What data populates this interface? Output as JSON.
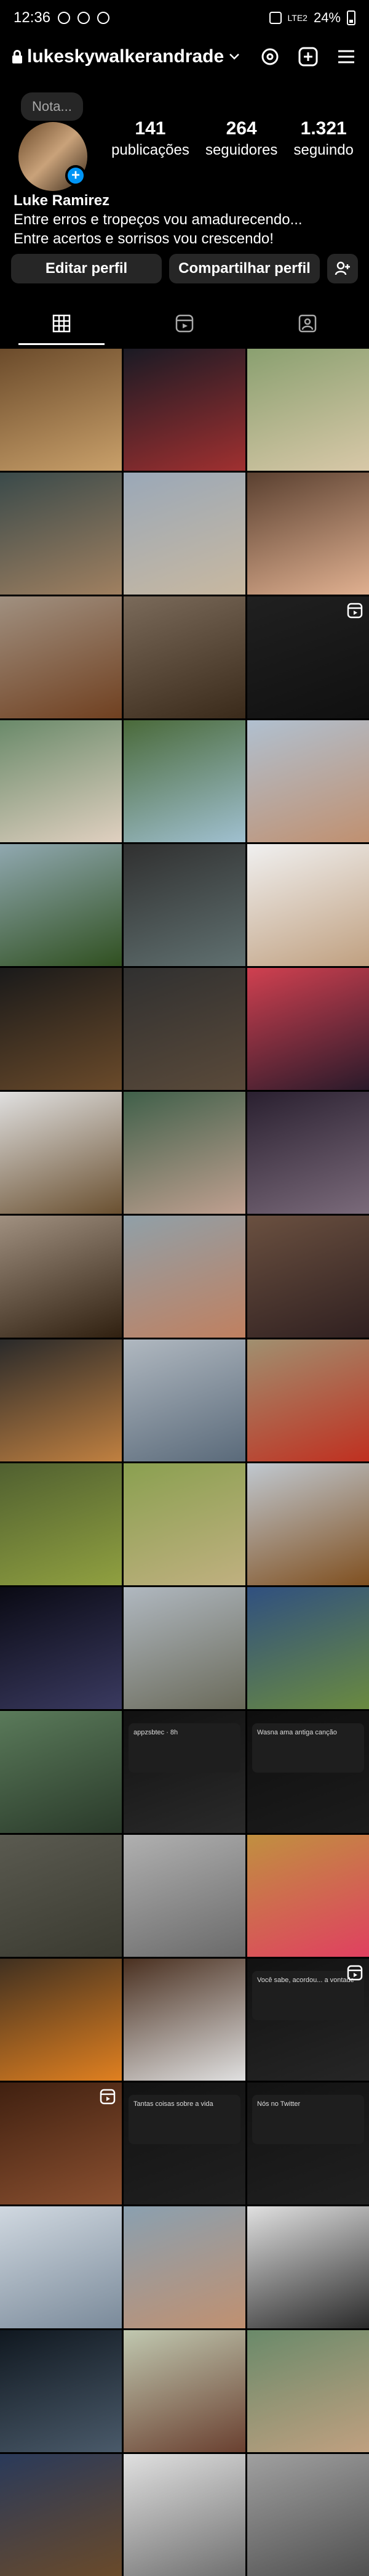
{
  "status_bar": {
    "time": "12:36",
    "battery": "24%",
    "network": "LTE2"
  },
  "header": {
    "username": "lukeskywalkerandrade"
  },
  "profile": {
    "note_placeholder": "Nota...",
    "stats": [
      {
        "number": "141",
        "label": "publicações"
      },
      {
        "number": "264",
        "label": "seguidores"
      },
      {
        "number": "1.321",
        "label": "seguindo"
      }
    ],
    "name": "Luke Ramirez",
    "bio_lines": [
      "Entre erros e tropeços vou amadurecendo...",
      "Entre acertos e sorrisos vou crescendo!"
    ]
  },
  "buttons": {
    "edit_profile": "Editar perfil",
    "share_profile": "Compartilhar perfil"
  },
  "tabs": [
    {
      "icon": "grid-icon",
      "active": true
    },
    {
      "icon": "reels-icon",
      "active": false
    },
    {
      "icon": "tagged-icon",
      "active": false
    }
  ],
  "grid": {
    "colors": [
      [
        "#6b4b2b",
        "#c9a06a"
      ],
      [
        "#1a1a24",
        "#a03030"
      ],
      [
        "#8aa070",
        "#d8c8a8"
      ],
      [
        "#3a4a4a",
        "#a08060"
      ],
      [
        "#9aa8b8",
        "#c8b8a0"
      ],
      [
        "#5a4030",
        "#e0b090"
      ],
      [
        "#a09080",
        "#704020"
      ],
      [
        "#7a6a5a",
        "#3a2a1a"
      ],
      [
        "#202020",
        "#101010"
      ],
      [
        "#6a8a6a",
        "#e0d0c0"
      ],
      [
        "#4a6a3a",
        "#a0c0d0"
      ],
      [
        "#b0c0d0",
        "#c09070"
      ],
      [
        "#90a8b0",
        "#305020"
      ],
      [
        "#303030",
        "#607070"
      ],
      [
        "#f0f0f0",
        "#c0a080"
      ],
      [
        "#1a1a1a",
        "#6a4a2a"
      ],
      [
        "#303030",
        "#5a4a3a"
      ],
      [
        "#d04050",
        "#2a1a2a"
      ],
      [
        "#e0e0e0",
        "#6a5030"
      ],
      [
        "#40604a",
        "#c0a090"
      ],
      [
        "#2a2030",
        "#7a6a7a"
      ],
      [
        "#a09080",
        "#302010"
      ],
      [
        "#90a0a8",
        "#c08060"
      ],
      [
        "#6a5040",
        "#302020"
      ],
      [
        "#2a2a2a",
        "#c08040"
      ],
      [
        "#b0b8c0",
        "#5a6a7a"
      ],
      [
        "#a09070",
        "#c03020"
      ],
      [
        "#506030",
        "#90a040"
      ],
      [
        "#8aa050",
        "#c0b080"
      ],
      [
        "#c0c8d0",
        "#805020"
      ],
      [
        "#0a0a14",
        "#3a3a60"
      ],
      [
        "#b0b8c0",
        "#6a6a5a"
      ],
      [
        "#305080",
        "#6a8a40"
      ],
      [
        "#5a7a5a",
        "#2a3a2a"
      ],
      [
        "#111111",
        "#2a2a2a"
      ],
      [
        "#0e0e0e",
        "#1c1c1c"
      ],
      [
        "#5a5a50",
        "#3a3a30"
      ],
      [
        "#b0b0b0",
        "#6a6a6a"
      ],
      [
        "#c09040",
        "#e04060"
      ],
      [
        "#403020",
        "#e08020"
      ],
      [
        "#4a3020",
        "#e0e0e0"
      ],
      [
        "#111111",
        "#262626"
      ],
      [
        "#402010",
        "#8a5030"
      ],
      [
        "#121212",
        "#202020"
      ],
      [
        "#121212",
        "#202020"
      ],
      [
        "#d0d8e0",
        "#7a8a9a"
      ],
      [
        "#8aa0b0",
        "#c09070"
      ],
      [
        "#e0e0e0",
        "#2a2a2a"
      ],
      [
        "#101820",
        "#4a5a6a"
      ],
      [
        "#c0c8b0",
        "#6a4030"
      ],
      [
        "#6a8a6a",
        "#c0a080"
      ],
      [
        "#2a3a5a",
        "#6a4a2a"
      ],
      [
        "#e0e0e0",
        "#707070"
      ],
      [
        "#a0a0a0",
        "#505050"
      ]
    ],
    "reels_index": [
      8,
      41,
      42
    ],
    "card_index": [
      34,
      35,
      41,
      43,
      44
    ],
    "card_text": [
      "appzsbtec · 8h",
      "Wasna ama antiga canção",
      "Você sabe, acordou... a vontade",
      "Tantas coisas sobre a vida",
      "Nós no Twitter",
      "appzsbtec"
    ]
  }
}
